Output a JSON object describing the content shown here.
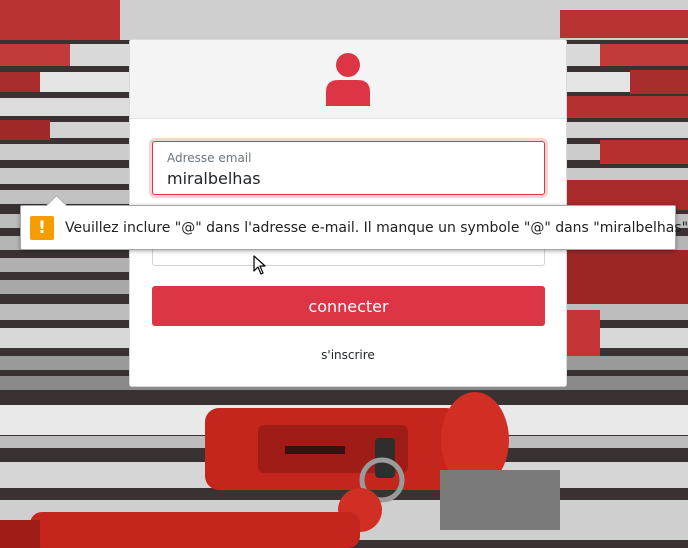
{
  "login": {
    "email_label": "Adresse email",
    "email_value": "miralbelhas",
    "password_value": "",
    "connect_label": "connecter",
    "register_label": "s'inscrire"
  },
  "validation": {
    "icon": "warning-icon",
    "message": "Veuillez inclure \"@\" dans l'adresse e-mail. Il manque un symbole \"@\" dans \"miralbelhas\"."
  },
  "colors": {
    "accent": "#dc3545",
    "warning": "#f59c00",
    "header_bg": "#f4f4f4"
  },
  "icons": {
    "avatar": "user-icon",
    "pointer": "mouse-cursor-icon"
  }
}
